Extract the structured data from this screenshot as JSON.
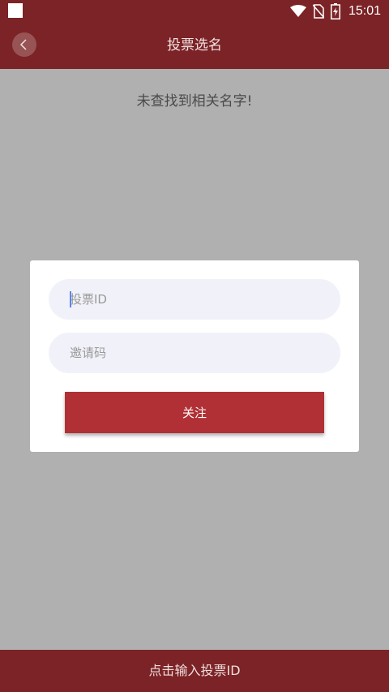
{
  "status_bar": {
    "time": "15:01",
    "icons": [
      "app-notification-icon",
      "wifi-icon",
      "no-sim-icon",
      "battery-charging-icon"
    ]
  },
  "app_bar": {
    "title": "投票选名",
    "back_icon": "chevron-left-icon"
  },
  "content": {
    "empty_message": "未查找到相关名字!"
  },
  "dialog": {
    "vote_id_placeholder": "投票ID",
    "invite_code_placeholder": "邀请码",
    "follow_label": "关注"
  },
  "bottom_bar": {
    "label": "点击输入投票ID"
  },
  "colors": {
    "brand": "#7b2326",
    "button": "#b03035",
    "overlay": "#b0b0b0",
    "input_bg": "#f1f2f9"
  }
}
